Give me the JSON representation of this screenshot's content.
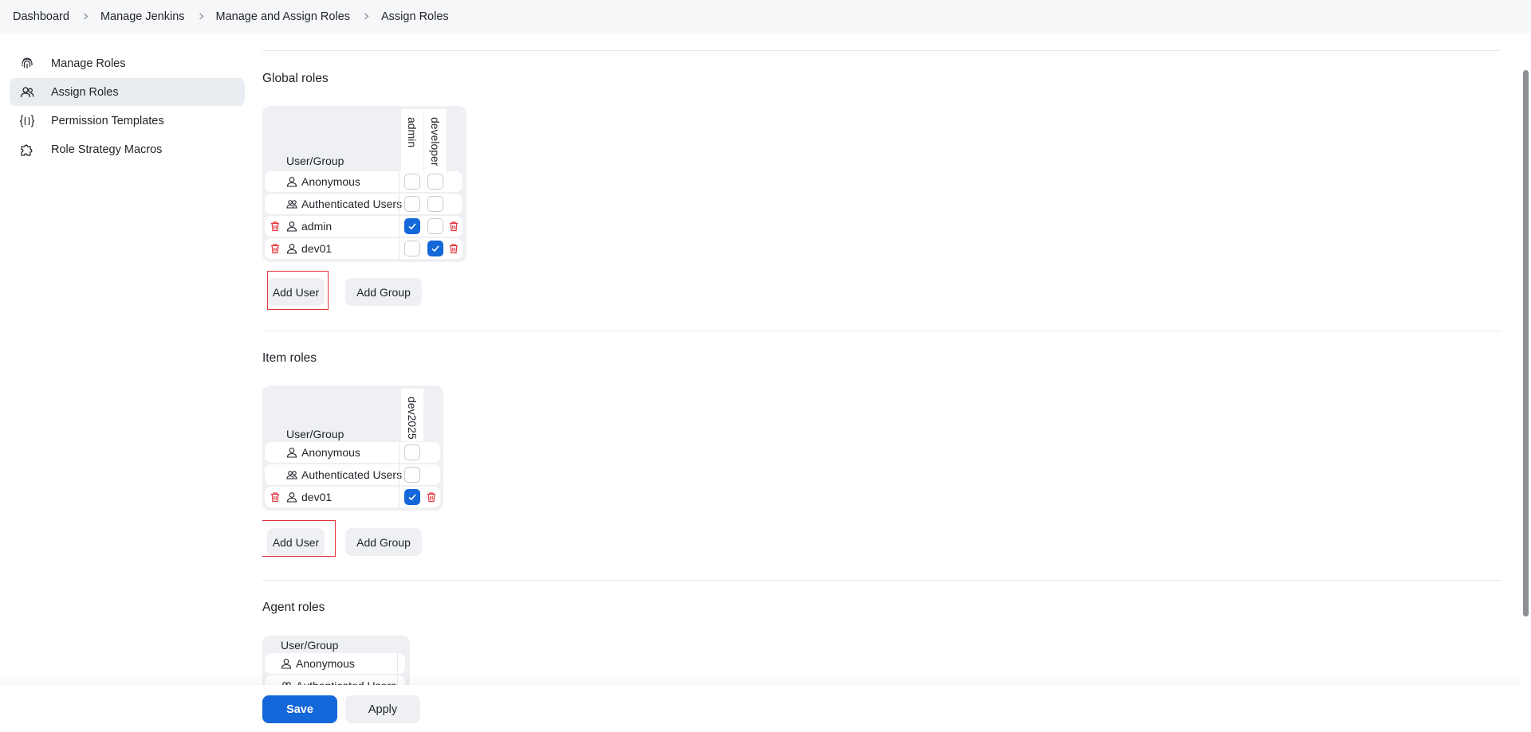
{
  "breadcrumb": [
    "Dashboard",
    "Manage Jenkins",
    "Manage and Assign Roles",
    "Assign Roles"
  ],
  "sidebar": {
    "items": [
      {
        "label": "Manage Roles",
        "icon": "fingerprint-icon",
        "active": false
      },
      {
        "label": "Assign Roles",
        "icon": "users-icon",
        "active": true
      },
      {
        "label": "Permission Templates",
        "icon": "braces-icon",
        "active": false
      },
      {
        "label": "Role Strategy Macros",
        "icon": "puzzle-icon",
        "active": false
      }
    ]
  },
  "global_roles": {
    "title": "Global roles",
    "header": "User/Group",
    "roles": [
      "admin",
      "developer"
    ],
    "rows": [
      {
        "name": "Anonymous",
        "icon": "user-icon",
        "deletable": false,
        "checks": [
          false,
          false
        ]
      },
      {
        "name": "Authenticated Users",
        "icon": "group-icon",
        "deletable": false,
        "checks": [
          false,
          false
        ]
      },
      {
        "name": "admin",
        "icon": "user-icon",
        "deletable": true,
        "checks": [
          true,
          false
        ]
      },
      {
        "name": "dev01",
        "icon": "user-icon",
        "deletable": true,
        "checks": [
          false,
          true
        ]
      }
    ],
    "add_user": "Add User",
    "add_group": "Add Group"
  },
  "item_roles": {
    "title": "Item roles",
    "header": "User/Group",
    "roles": [
      "dev2025"
    ],
    "rows": [
      {
        "name": "Anonymous",
        "icon": "user-icon",
        "deletable": false,
        "checks": [
          false
        ]
      },
      {
        "name": "Authenticated Users",
        "icon": "group-icon",
        "deletable": false,
        "checks": [
          false
        ]
      },
      {
        "name": "dev01",
        "icon": "user-icon",
        "deletable": true,
        "checks": [
          true
        ]
      }
    ],
    "add_user": "Add User",
    "add_group": "Add Group"
  },
  "agent_roles": {
    "title": "Agent roles",
    "header": "User/Group",
    "rows": [
      {
        "name": "Anonymous",
        "icon": "user-icon"
      },
      {
        "name": "Authenticated Users",
        "icon": "group-icon"
      }
    ]
  },
  "footer": {
    "save": "Save",
    "apply": "Apply"
  },
  "colors": {
    "primary": "#1467d8",
    "danger": "#e3333b",
    "card": "#eef0f3"
  }
}
